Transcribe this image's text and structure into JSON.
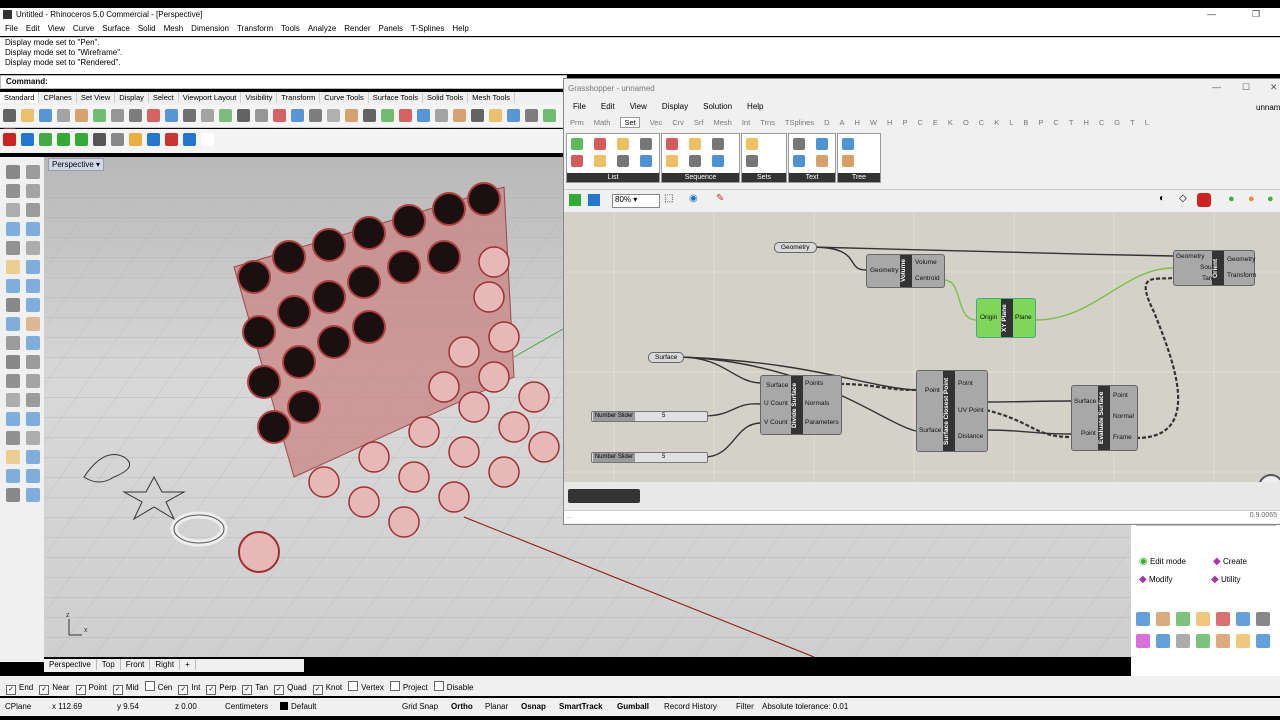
{
  "window": {
    "title": "Untitled - Rhinoceros 5.0 Commercial - [Perspective]"
  },
  "menu": [
    "File",
    "Edit",
    "View",
    "Curve",
    "Surface",
    "Solid",
    "Mesh",
    "Dimension",
    "Transform",
    "Tools",
    "Analyze",
    "Render",
    "Panels",
    "T-Splines",
    "Help"
  ],
  "history": [
    "Display mode set to \"Pen\".",
    "Display mode set to \"Wireframe\".",
    "Display mode set to \"Rendered\"."
  ],
  "command": {
    "label": "Command:",
    "value": ""
  },
  "toolbar_tabs": [
    "Standard",
    "CPlanes",
    "Set View",
    "Display",
    "Select",
    "Viewport Layout",
    "Visibility",
    "Transform",
    "Curve Tools",
    "Surface Tools",
    "Solid Tools",
    "Mesh Tools"
  ],
  "viewport": {
    "name": "Perspective"
  },
  "viewport_tabs": [
    "Perspective",
    "Top",
    "Front",
    "Right",
    "+"
  ],
  "osnaps": [
    {
      "label": "End",
      "checked": true
    },
    {
      "label": "Near",
      "checked": true
    },
    {
      "label": "Point",
      "checked": true
    },
    {
      "label": "Mid",
      "checked": true
    },
    {
      "label": "Cen",
      "checked": false
    },
    {
      "label": "Int",
      "checked": true
    },
    {
      "label": "Perp",
      "checked": true
    },
    {
      "label": "Tan",
      "checked": true
    },
    {
      "label": "Quad",
      "checked": true
    },
    {
      "label": "Knot",
      "checked": true
    },
    {
      "label": "Vertex",
      "checked": false
    },
    {
      "label": "Project",
      "checked": false
    },
    {
      "label": "Disable",
      "checked": false
    }
  ],
  "status": {
    "cplane": "CPlane",
    "x": "x 112.69",
    "y": "y 9.54",
    "z": "z 0.00",
    "units": "Centimeters",
    "layer": "Default",
    "grid_snap": "Grid Snap",
    "ortho": "Ortho",
    "planar": "Planar",
    "osnap": "Osnap",
    "smarttrack": "SmartTrack",
    "gumball": "Gumball",
    "record_history": "Record History",
    "filter": "Filter",
    "tolerance": "Absolute tolerance: 0.01"
  },
  "panel": {
    "edit_mode": "Edit mode",
    "create": "Create",
    "modify": "Modify",
    "utility": "Utility"
  },
  "grasshopper": {
    "title": "Grasshopper - unnamed",
    "doc": "unnam",
    "menu": [
      "File",
      "Edit",
      "View",
      "Display",
      "Solution",
      "Help"
    ],
    "tabs": [
      "Prm",
      "Math",
      "Set",
      "Vec",
      "Crv",
      "Srf",
      "Mesh",
      "Int",
      "Trns",
      "TSplines",
      "D",
      "A",
      "H",
      "W",
      "H",
      "P",
      "C",
      "E",
      "K",
      "O",
      "C",
      "K",
      "L",
      "B",
      "P",
      "C",
      "T",
      "H",
      "C",
      "G",
      "T",
      "L"
    ],
    "active_tab": "Set",
    "groups": [
      "List",
      "Sequence",
      "Sets",
      "Text",
      "Tree"
    ],
    "zoom": "80%",
    "version": "0.9.0065",
    "components": {
      "geometry_param": "Geometry",
      "surface_param": "Surface",
      "volume": {
        "name": "Volume",
        "in": [
          "Geometry"
        ],
        "out": [
          "Volume",
          "Centroid"
        ]
      },
      "xyplane": {
        "name": "XY Plane",
        "in": [
          "Origin"
        ],
        "out": [
          "Plane"
        ]
      },
      "orient": {
        "name": "Orient",
        "in": [
          "Geometry",
          "Source",
          "Target"
        ],
        "out": [
          "Geometry",
          "Transform"
        ]
      },
      "divide": {
        "name": "Divide Surface",
        "in": [
          "Surface",
          "U Count",
          "V Count"
        ],
        "out": [
          "Points",
          "Normals",
          "Parameters"
        ]
      },
      "closest": {
        "name": "Surface Closest Point",
        "in": [
          "Point",
          "Surface"
        ],
        "out": [
          "Point",
          "UV Point",
          "Distance"
        ]
      },
      "evaluate": {
        "name": "Evaluate Surface",
        "in": [
          "Surface",
          "Point"
        ],
        "out": [
          "Point",
          "Normal",
          "Frame"
        ]
      },
      "slider1": {
        "label": "Number Slider",
        "value": "5"
      },
      "slider2": {
        "label": "Number Slider",
        "value": "5"
      }
    }
  }
}
